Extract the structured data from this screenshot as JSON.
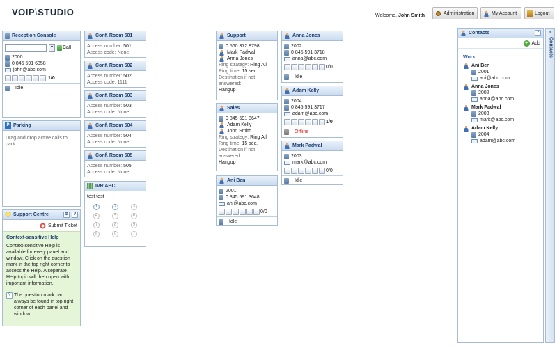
{
  "header": {
    "logo": "VOIP\\STUDIO",
    "logo_left": "VOIP",
    "logo_right": "STUDIO",
    "welcome_prefix": "Welcome,",
    "user_name": "John Smith",
    "buttons": {
      "administration": "Administration",
      "my_account": "My Account",
      "logout": "Logout"
    }
  },
  "reception": {
    "title": "Reception Console",
    "call_button": "Call",
    "extension": "2000",
    "phone": "0 845 591 6358",
    "email": "john@abc.com",
    "counter": "1/0",
    "status": "Idle"
  },
  "parking": {
    "title": "Parking",
    "text": "Drag and drop active calls to park."
  },
  "support_centre": {
    "title": "Support Centre",
    "submit_ticket": "Submit Ticket",
    "help_title": "Context-sensitive Help",
    "help_text": "Context-sensitive Help is available for every panel and window. Click on the question mark in the top right corner to access the Help. A separate Help topic will then open with important information.",
    "help_note": "The question mark can always be found in top right corner of each panel and window."
  },
  "conf_rooms": [
    {
      "title": "Conf. Room 501",
      "access_number_label": "Access number:",
      "access_number": "501",
      "access_code_label": "Access code:",
      "access_code": "None"
    },
    {
      "title": "Conf. Room 502",
      "access_number_label": "Access number:",
      "access_number": "502",
      "access_code_label": "Access code:",
      "access_code": "1111"
    },
    {
      "title": "Conf. Room 503",
      "access_number_label": "Access number:",
      "access_number": "503",
      "access_code_label": "Access code:",
      "access_code": "None"
    },
    {
      "title": "Conf. Room 504",
      "access_number_label": "Access number:",
      "access_number": "504",
      "access_code_label": "Access code:",
      "access_code": "None"
    },
    {
      "title": "Conf. Room 505",
      "access_number_label": "Access number:",
      "access_number": "505",
      "access_code_label": "Access code:",
      "access_code": "None"
    }
  ],
  "ivr": {
    "title": "IVR ABC",
    "text": "test test",
    "keys": [
      "1",
      "2",
      "3",
      "4",
      "5",
      "6",
      "7",
      "8",
      "9",
      "#",
      "0",
      "*"
    ]
  },
  "support_queue": {
    "title": "Support",
    "phone": "0 560 372 8798",
    "members": [
      "Mark Padwal",
      "Anna Jones"
    ],
    "ring_strategy_label": "Ring strategy:",
    "ring_strategy": "Ring All",
    "ring_time_label": "Ring time:",
    "ring_time": "15 sec.",
    "destination_label": "Destination if not answered:",
    "destination": "Hangup"
  },
  "sales_queue": {
    "title": "Sales",
    "phone": "0 845 591 3647",
    "members": [
      "Adam Kelly",
      "John Smith"
    ],
    "ring_strategy_label": "Ring strategy:",
    "ring_strategy": "Ring All",
    "ring_time_label": "Ring time:",
    "ring_time": "15 sec.",
    "destination_label": "Destination if not answered:",
    "destination": "Hangup"
  },
  "users": {
    "ani_ben": {
      "title": "Ani Ben",
      "extension": "2001",
      "phone": "0 845 591 3648",
      "email": "ani@abc.com",
      "counter": "0/0",
      "status": "Idle"
    },
    "anna_jones": {
      "title": "Anna Jones",
      "extension": "2002",
      "phone": "0 845 591 3718",
      "email": "anna@abc.com",
      "counter": "0/0",
      "status": "Idle"
    },
    "adam_kelly": {
      "title": "Adam Kelly",
      "extension": "2004",
      "phone": "0 845 591 3717",
      "email": "adam@abc.com",
      "counter": "1/0",
      "status": "Offline"
    },
    "mark_padwal": {
      "title": "Mark Padwal",
      "extension": "2003",
      "email": "mark@abc.com",
      "counter": "0/0",
      "status": "Idle"
    }
  },
  "contacts": {
    "title": "Contacts",
    "add_button": "Add",
    "group_label": "Work:",
    "side_tab": "Contacts",
    "items": [
      {
        "name": "Ani Ben",
        "extension": "2001",
        "email": "ani@abc.com"
      },
      {
        "name": "Anna Jones",
        "extension": "2002",
        "email": "anna@abc.com"
      },
      {
        "name": "Mark Padwal",
        "extension": "2003",
        "email": "mark@abc.com"
      },
      {
        "name": "Adam Kelly",
        "extension": "2004",
        "email": "adam@abc.com"
      }
    ]
  },
  "colors": {
    "panel_border": "#a7bdd6",
    "header_text": "#1c3f6e",
    "help_bg": "#e5f5d8",
    "offline": "#e02020"
  }
}
